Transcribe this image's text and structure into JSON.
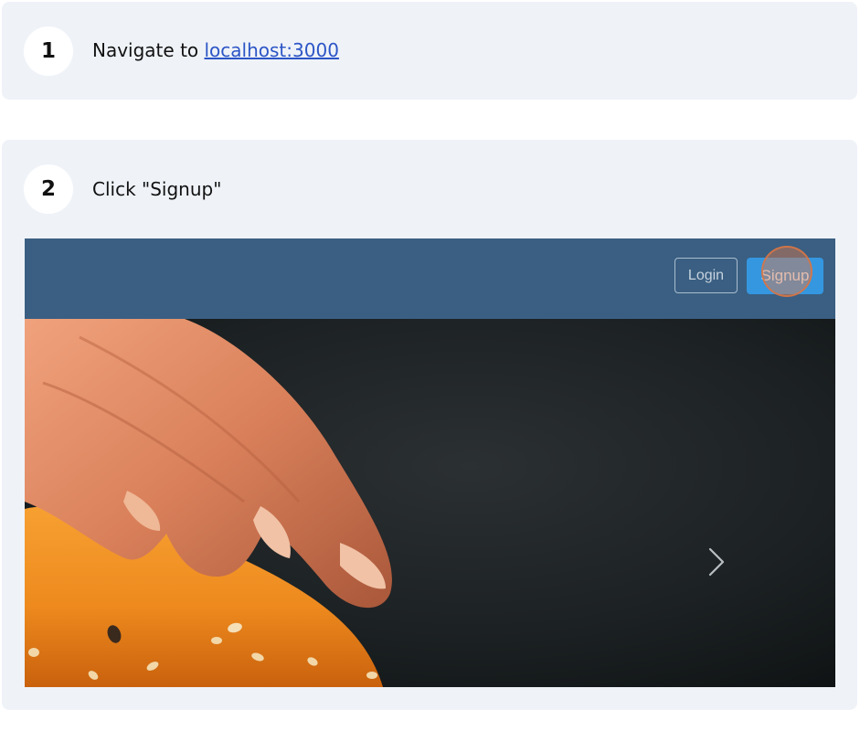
{
  "steps": [
    {
      "number": "1",
      "text_prefix": "Navigate to ",
      "link_text": "localhost:3000"
    },
    {
      "number": "2",
      "text": "Click \"Signup\"",
      "screenshot": {
        "nav": {
          "login_label": "Login",
          "signup_label": "Signup"
        },
        "hero": {
          "next_icon": "chevron-right-icon"
        }
      }
    }
  ],
  "colors": {
    "card_bg": "#eff3f8",
    "link": "#2c55c6",
    "nav_bg": "#3a5f82",
    "signup_bg": "#3597e0",
    "click_marker": "#de7848"
  }
}
